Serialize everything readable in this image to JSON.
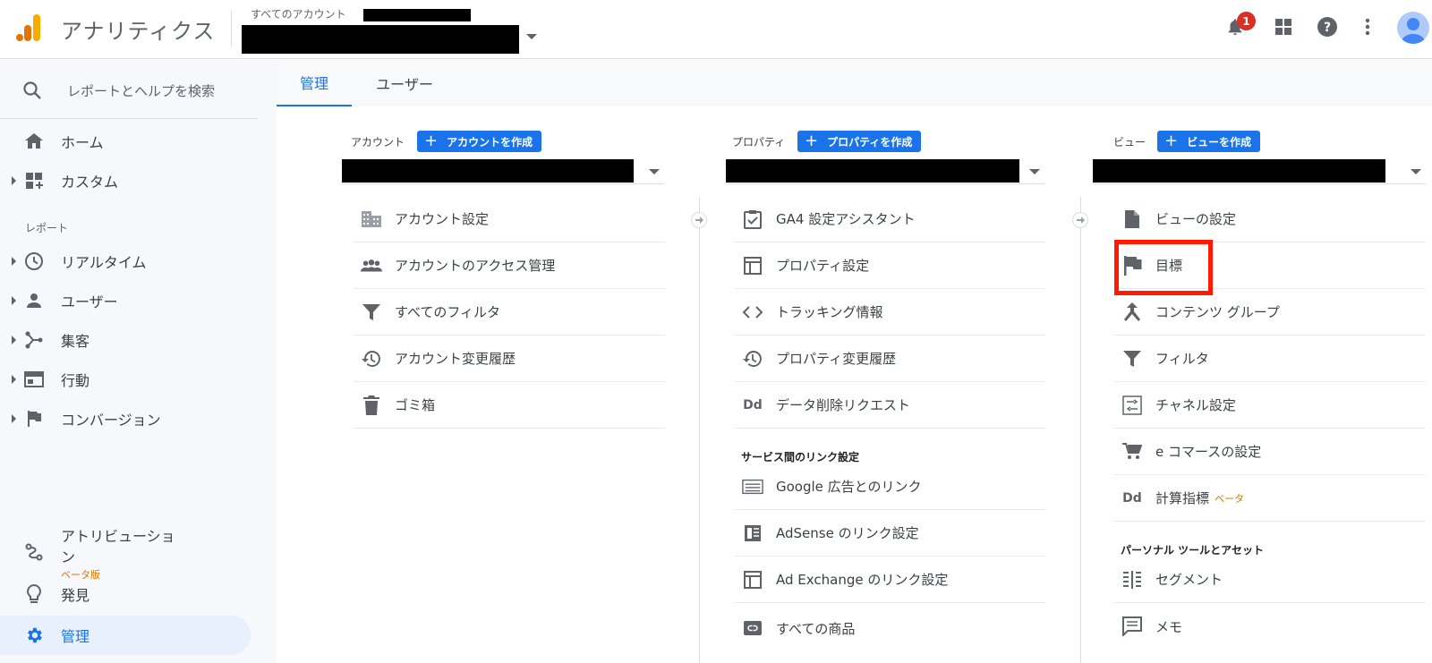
{
  "header": {
    "app_title": "アナリティクス",
    "account_label": "すべてのアカウント",
    "notification_count": "1",
    "icons": [
      "bell-icon",
      "apps-grid-icon",
      "help-icon",
      "more-vert-icon",
      "avatar"
    ]
  },
  "sidebar": {
    "search_placeholder": "レポートとヘルプを検索",
    "home": "ホーム",
    "custom": "カスタム",
    "reports_section": "レポート",
    "items": [
      {
        "label": "リアルタイム",
        "icon": "clock-icon"
      },
      {
        "label": "ユーザー",
        "icon": "person-icon"
      },
      {
        "label": "集客",
        "icon": "acquisition-icon"
      },
      {
        "label": "行動",
        "icon": "behavior-icon"
      },
      {
        "label": "コンバージョン",
        "icon": "flag-icon"
      }
    ],
    "attribution": "アトリビューション",
    "attribution_beta": "ベータ版",
    "discover": "発見",
    "admin": "管理"
  },
  "tabs": {
    "admin": "管理",
    "user": "ユーザー"
  },
  "account_col": {
    "label": "アカウント",
    "create": "アカウントを作成",
    "items": [
      "アカウント設定",
      "アカウントのアクセス管理",
      "すべてのフィルタ",
      "アカウント変更履歴",
      "ゴミ箱"
    ]
  },
  "property_col": {
    "label": "プロパティ",
    "create": "プロパティを作成",
    "items": [
      "GA4 設定アシスタント",
      "プロパティ設定",
      "トラッキング情報",
      "プロパティ変更履歴",
      "データ削除リクエスト"
    ],
    "dd_icon": "Dd",
    "link_section": "サービス間のリンク設定",
    "link_items": [
      "Google 広告とのリンク",
      "AdSense のリンク設定",
      "Ad Exchange のリンク設定",
      "すべての商品"
    ]
  },
  "view_col": {
    "label": "ビュー",
    "create": "ビューを作成",
    "items": [
      "ビューの設定",
      "目標",
      "コンテンツ グループ",
      "フィルタ",
      "チャネル設定",
      "e コマースの設定",
      "計算指標"
    ],
    "dd_icon": "Dd",
    "beta": "ベータ",
    "personal_section": "パーソナル ツールとアセット",
    "personal_items": [
      "セグメント",
      "メモ"
    ]
  },
  "colors": {
    "accent": "#1a73e8",
    "highlight": "#ff1a00",
    "beta": "#e37400"
  }
}
